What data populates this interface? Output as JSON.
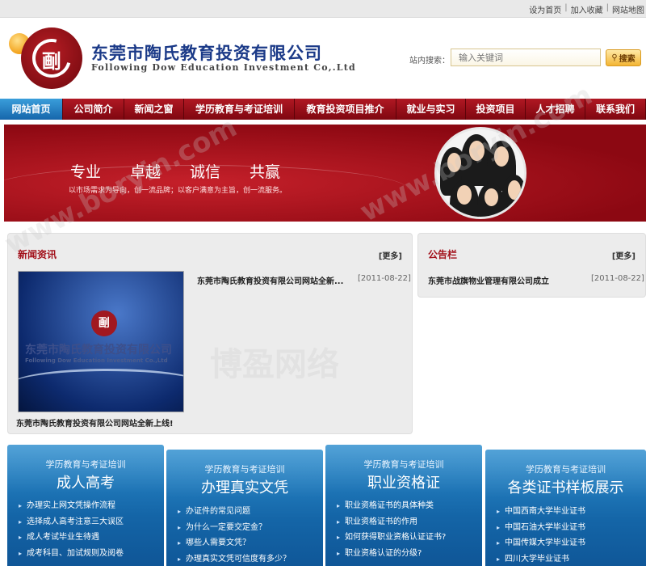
{
  "toplinks": {
    "home": "设为首页",
    "fav": "加入收藏",
    "sitemap": "网站地图",
    "sep": "|"
  },
  "header": {
    "brand_cn": "东莞市陶氏教育投资有限公司",
    "brand_en": "Following Dow Education Investment Co,.Ltd",
    "logo_glyph": "㓰"
  },
  "search": {
    "label": "站内搜索：",
    "placeholder": "输入关键词",
    "button": "搜索",
    "button_icon": "search-icon"
  },
  "nav": {
    "items": [
      {
        "label": "网站首页",
        "active": true
      },
      {
        "label": "公司简介"
      },
      {
        "label": "新闻之窗"
      },
      {
        "label": "学历教育与考证培训"
      },
      {
        "label": "教育投资项目推介"
      },
      {
        "label": "就业与实习"
      },
      {
        "label": "投资项目"
      },
      {
        "label": "人才招聘"
      },
      {
        "label": "联系我们"
      }
    ]
  },
  "banner": {
    "slogans": [
      "专业",
      "卓越",
      "诚信",
      "共赢"
    ],
    "subtitle": "以市场需求为导向，创一流品牌；以客户满意为主旨，创一流服务。"
  },
  "news": {
    "title": "新闻资讯",
    "more": "[更多]",
    "thumb_cn": "东莞市陶氏教育投资有限公司",
    "thumb_en": "Following Dow Education Investment Co.,Ltd",
    "thumb_caption": "东莞市陶氏教育投资有限公司网站全新上线!",
    "items": [
      {
        "title": "东莞市陶氏教育投资有限公司网站全新...",
        "date": "[2011-08-22]"
      }
    ]
  },
  "notice": {
    "title": "公告栏",
    "more": "[更多]",
    "items": [
      {
        "title": "东莞市战旗物业管理有限公司成立",
        "date": "[2011-08-22]"
      }
    ]
  },
  "features": [
    {
      "sub": "学历教育与考证培训",
      "title": "成人高考",
      "items": [
        "办理实上网文凭操作流程",
        "选择成人高考注意三大误区",
        "成人考试毕业生待遇",
        "成考科目、加试规则及阅卷"
      ]
    },
    {
      "sub": "学历教育与考证培训",
      "title": "办理真实文凭",
      "items": [
        "办证件的常见问题",
        "为什么一定要交定金？",
        "哪些人需要文凭？",
        "办理真实文凭可信度有多少？"
      ]
    },
    {
      "sub": "学历教育与考证培训",
      "title": "职业资格证",
      "items": [
        "职业资格证书的具体种类",
        "职业资格证书的作用",
        "如何获得职业资格认证证书?",
        "职业资格认证的分级?"
      ]
    },
    {
      "sub": "学历教育与考证培训",
      "title": "各类证书样板展示",
      "items": [
        "中国西南大学毕业证书",
        "中国石油大学毕业证书",
        "中国传媒大学毕业证书",
        "四川大学毕业证书"
      ]
    }
  ],
  "watermarks": [
    "www.boryin.com",
    "www.boryin.com",
    "博盈网络"
  ]
}
